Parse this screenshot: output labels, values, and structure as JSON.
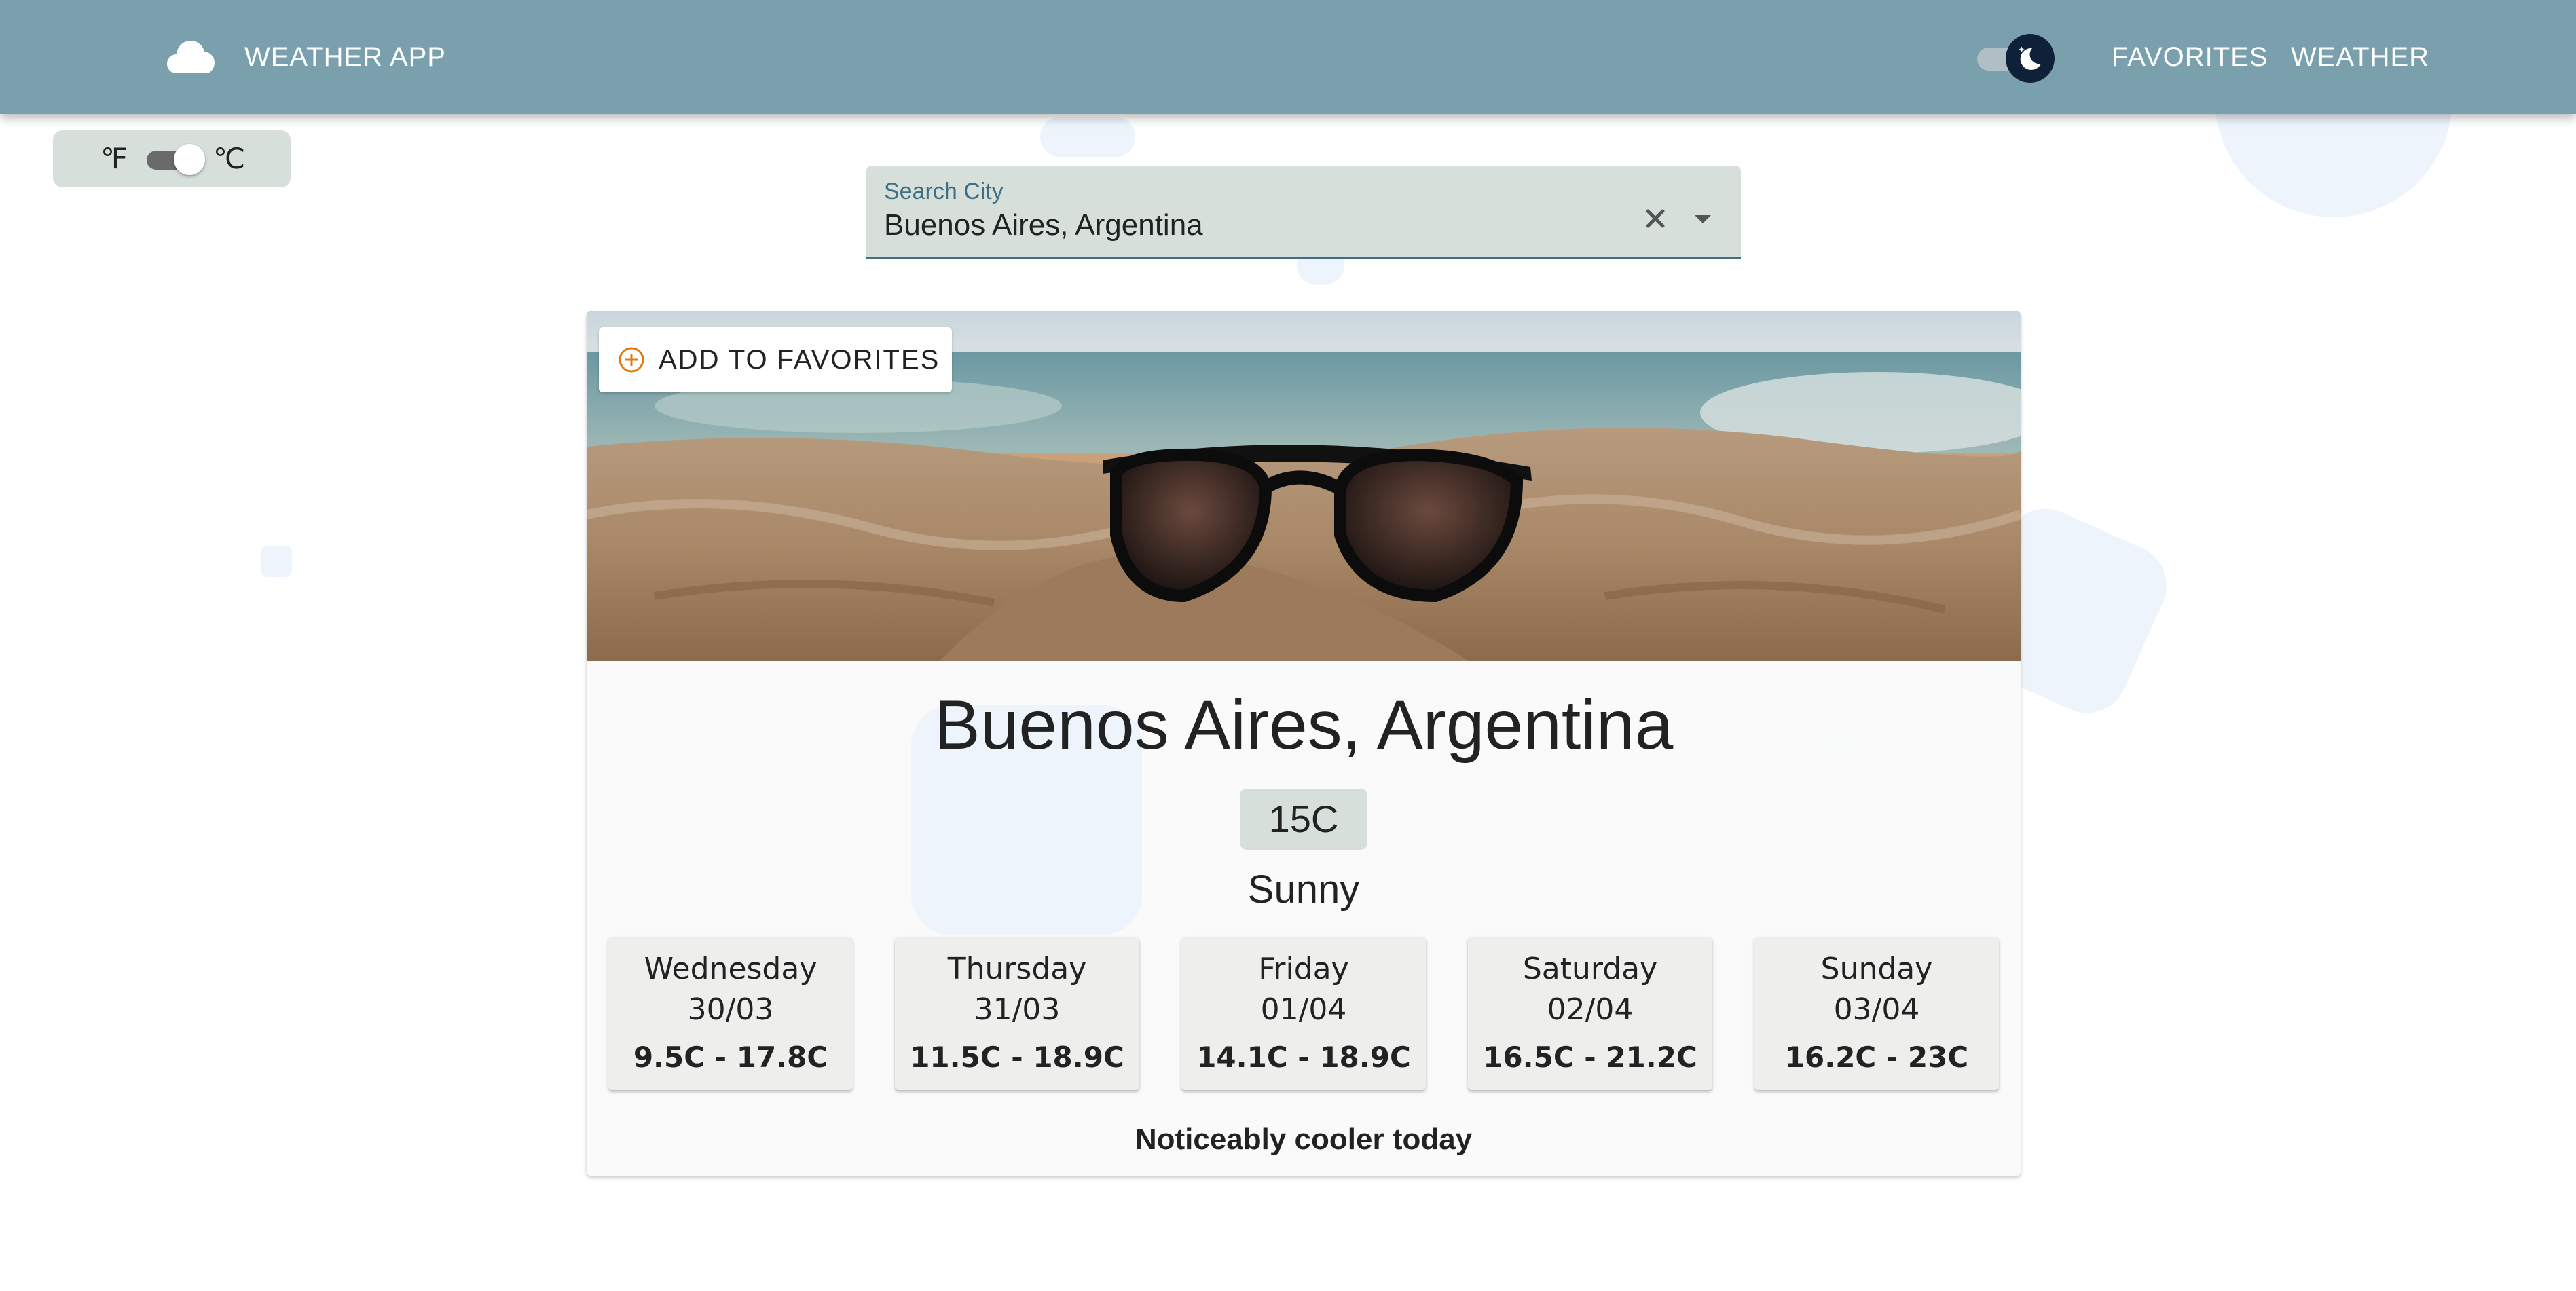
{
  "app": {
    "title": "WEATHER APP",
    "logo_icon": "cloud-icon",
    "theme_toggle": {
      "mode": "dark",
      "icon": "moon-icon"
    }
  },
  "nav": {
    "links": [
      {
        "label": "FAVORITES"
      },
      {
        "label": "WEATHER"
      }
    ]
  },
  "units": {
    "fahrenheit_label": "℉",
    "celsius_label": "℃",
    "selected": "celsius"
  },
  "search": {
    "label": "Search City",
    "value": "Buenos Aires, Argentina",
    "clear_icon": "close-icon",
    "dropdown_icon": "arrow-drop-down-icon"
  },
  "card": {
    "favorite_button": {
      "label": "ADD TO FAVORITES",
      "icon": "add-circle-outline-icon"
    },
    "city": "Buenos Aires, Argentina",
    "temperature": "15C",
    "condition": "Sunny",
    "forecast": [
      {
        "day": "Wednesday",
        "date": "30/03",
        "range": "9.5C - 17.8C"
      },
      {
        "day": "Thursday",
        "date": "31/03",
        "range": "11.5C - 18.9C"
      },
      {
        "day": "Friday",
        "date": "01/04",
        "range": "14.1C - 18.9C"
      },
      {
        "day": "Saturday",
        "date": "02/04",
        "range": "16.5C - 21.2C"
      },
      {
        "day": "Sunday",
        "date": "03/04",
        "range": "16.2C - 23C"
      }
    ],
    "summary": "Noticeably cooler today"
  },
  "colors": {
    "app_bar": "#7aa0ad",
    "chip": "#d7dfdb",
    "accent": "#3f6f82",
    "favorite_icon": "#e07a10",
    "theme_thumb": "#0f2139"
  }
}
